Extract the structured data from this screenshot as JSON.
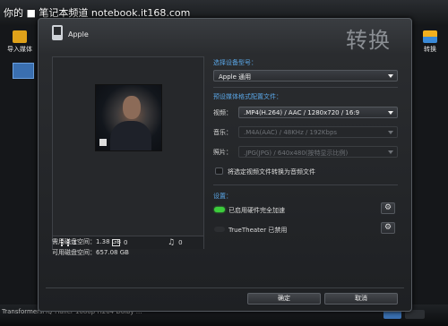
{
  "watermark": "你的 ■ 笔记本频道 notebook.it168.com",
  "bg": {
    "left_tool_label": "导入媒体",
    "right_tool_label": "转换",
    "status_text": "TransformersHQ-Haller 1080p H264 Dolby  ..."
  },
  "dialog": {
    "device_name": "Apple",
    "big_title": "转换",
    "preview": {
      "video_count": "1",
      "image_count": "0",
      "audio_count": "0"
    },
    "disk_required": "需用磁盘空间：1.38 GB",
    "disk_available": "可用磁盘空间：657.08 GB",
    "device_model_label": "选择设备型号：",
    "device_model_value": "Apple 通用",
    "preset_label": "预设媒体格式配置文件：",
    "video_label": "视频：",
    "video_value": ".MP4(H.264) / AAC / 1280x720 / 16:9",
    "audio_label": "音乐：",
    "audio_value": ".M4A(AAC) / 48KHz / 192Kbps",
    "photo_label": "照片：",
    "photo_value": ".JPG(JPG) / 640x480(按特显示比例)",
    "convert_audio_label": "将选定视频文件转换为音频文件",
    "settings_label": "设置：",
    "hw_accel_label": "已启用硬件完全加速",
    "truetheater_label": "TrueTheater 已禁用",
    "ok_button": "确定",
    "cancel_button": "取消"
  },
  "colors": {
    "accent_blue": "#5aa6e6",
    "toggle_green": "#3ccc3c"
  }
}
